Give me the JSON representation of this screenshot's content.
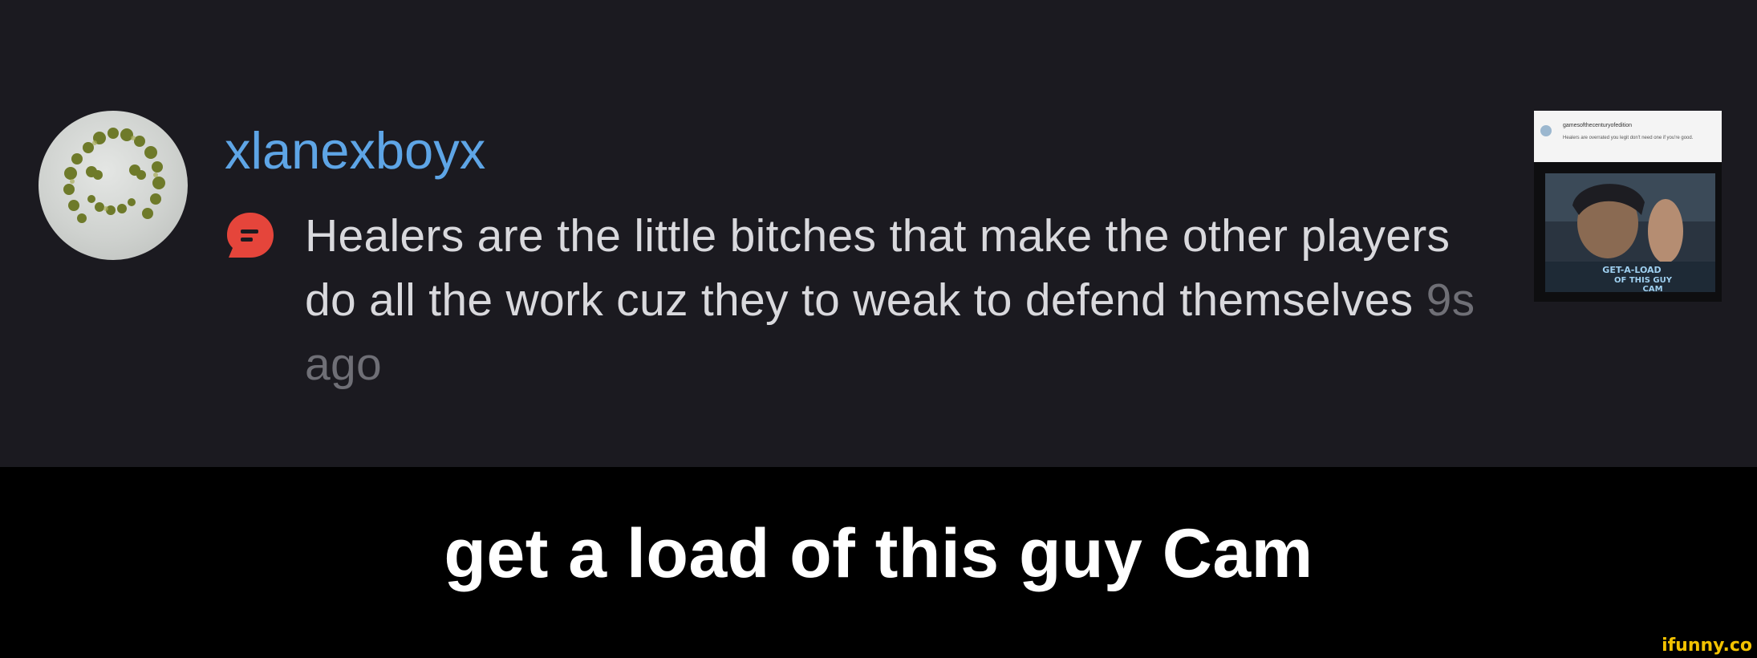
{
  "notification": {
    "username": "xlanexboyx",
    "comment_icon": "comment-bubble-icon",
    "comment_text": "Healers are the little bitches that make the other players do all the work cuz they to weak to defend themselves",
    "timestamp": "9s ago",
    "thumbnail": {
      "username": "gamesofthecenturyofedition",
      "text": "Healers are overrated you legit don't need one if you're good.",
      "image_text": "GET-A-LOAD OF THIS GUY CAM"
    }
  },
  "caption": "get a load of this guy Cam",
  "watermark": "ifunny.co",
  "colors": {
    "background": "#1b1a20",
    "username": "#5ea5e6",
    "comment_icon": "#e5453b",
    "text": "#d9d9dd",
    "timestamp": "#6f6f76",
    "caption_bar": "#000000",
    "caption": "#ffffff",
    "watermark": "#f2c200"
  }
}
